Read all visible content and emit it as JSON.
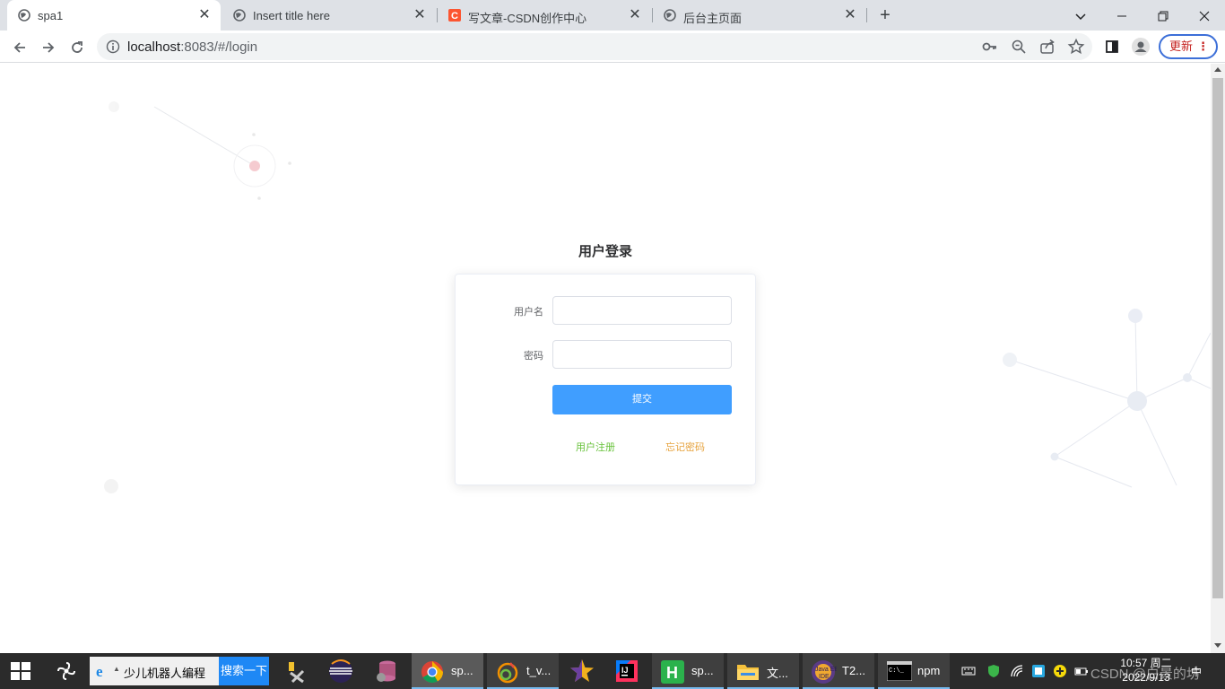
{
  "browser": {
    "tabs": [
      {
        "title": "spa1",
        "active": true
      },
      {
        "title": "Insert title here",
        "active": false
      },
      {
        "title": "写文章-CSDN创作中心",
        "active": false
      },
      {
        "title": "后台主页面",
        "active": false
      }
    ],
    "url_host": "localhost",
    "url_rest": ":8083/#/login",
    "update_label": "更新"
  },
  "login": {
    "title": "用户登录",
    "username_label": "用户名",
    "username_value": "",
    "password_label": "密码",
    "password_value": "",
    "submit_label": "提交",
    "register_link": "用户注册",
    "forgot_link": "忘记密码"
  },
  "colors": {
    "primary": "#409eff",
    "register_link": "#67c23a",
    "forgot_link": "#e6a23c"
  },
  "taskbar": {
    "search_text": "少儿机器人编程",
    "search_button": "搜索一下",
    "apps": [
      {
        "label": "sp...",
        "icon": "chrome-icon"
      },
      {
        "label": "t_v...",
        "icon": "app-icon"
      },
      {
        "label": "",
        "icon": "star-icon"
      },
      {
        "label": "",
        "icon": "intellij-icon"
      },
      {
        "label": "sp...",
        "icon": "hbuilder-icon"
      },
      {
        "label": "文...",
        "icon": "folder-icon"
      },
      {
        "label": "T2...",
        "icon": "javaee-ide-icon"
      },
      {
        "label": "npm",
        "icon": "terminal-icon"
      }
    ],
    "time": "10:57 周二",
    "date": "2022/9/13",
    "ime": "中",
    "watermark": "CSDN @白景的坊"
  }
}
